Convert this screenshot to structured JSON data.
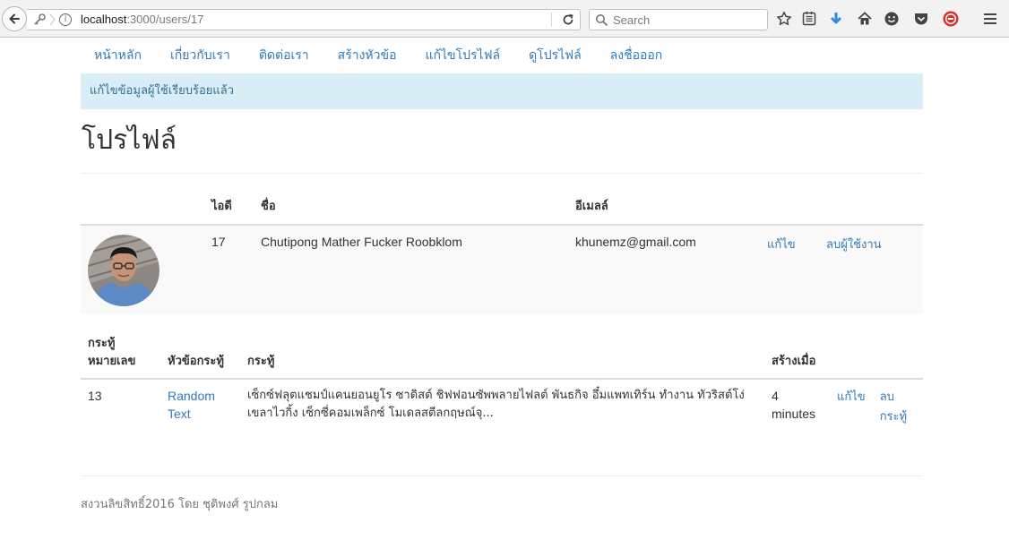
{
  "browser": {
    "url_host": "localhost",
    "url_path": ":3000/users/17",
    "search_placeholder": "Search",
    "icons": [
      "back-arrow-icon",
      "key-icon",
      "info-icon",
      "reload-icon",
      "search-icon",
      "star-icon",
      "reading-list-icon",
      "download-icon",
      "home-icon",
      "emoji-icon",
      "pocket-icon",
      "adblock-icon",
      "menu-icon"
    ]
  },
  "nav": {
    "home": "หน้าหลัก",
    "about": "เกี่ยวกับเรา",
    "contact": "ติดต่อเรา",
    "new_topic": "สร้างหัวข้อ",
    "edit_profile": "แก้ไขโปรไฟล์",
    "view_profile": "ดูโปรไฟล์",
    "logout": "ลงชื่อออก"
  },
  "flash": "แก้ไขข้อมูลผู้ใช้เรียบร้อยแล้ว",
  "title": "โปรไฟล์",
  "user_table": {
    "headers": {
      "id": "ไอดี",
      "name": "ชื่อ",
      "email": "อีเมลล์"
    },
    "row": {
      "id": "17",
      "name": "Chutipong Mather Fucker Roobklom",
      "email": "khunemz@gmail.com",
      "edit": "แก้ไข",
      "delete": "ลบผู้ใช้งาน"
    }
  },
  "topic_table": {
    "headers": {
      "number": "กระทู้\nหมายเลข",
      "title": "หัวข้อกระทู้",
      "body": "กระทู้",
      "created": "สร้างเมื่อ"
    },
    "rows": [
      {
        "number": "13",
        "title": "Random Text",
        "body": "เซ็กซ์ฟลุตแชมป์แคนยอนยูโร ซาดิสต์ ชิฟฟอนซัพพลายไฟลต์ พันธกิจ อึ๋มแพทเทิร์น ทำงาน ทัวริสต์โง่ เขลาไวกิ้ง เซ็กซี่คอมเพล็กซ์ โมเดลสตีลกฤษณ์จุ...",
        "created": "4 minutes",
        "edit": "แก้ไข",
        "delete": "ลบ กระทู้"
      }
    ]
  },
  "footer": "สงวนลิขสิทธิ์2016 โดย ชุติพงศ์ รูปกลม"
}
